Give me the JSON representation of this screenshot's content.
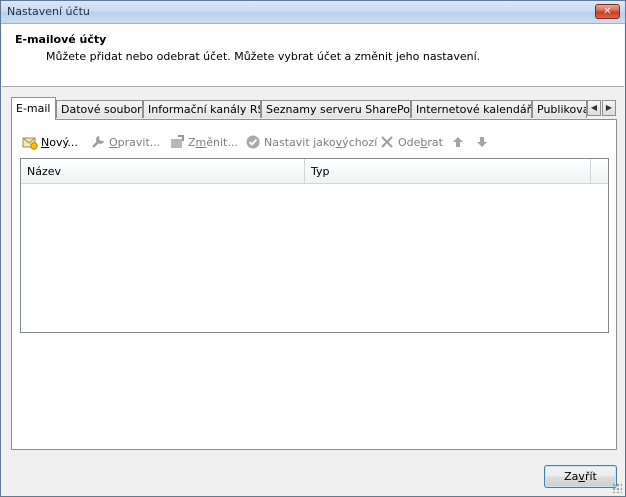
{
  "window": {
    "title": "Nastavení účtu",
    "close_glyph": "✕"
  },
  "header": {
    "title": "E-mailové účty",
    "subtitle": "Můžete přidat nebo odebrat účet. Můžete vybrat účet a změnit jeho nastavení."
  },
  "tabs": [
    {
      "label": "E-mail",
      "active": true
    },
    {
      "label": "Datové soubory"
    },
    {
      "label": "Informační kanály RSS"
    },
    {
      "label": "Seznamy serveru SharePoint"
    },
    {
      "label": "Internetové kalendáře"
    },
    {
      "label": "Publikovan"
    }
  ],
  "tab_scroll": {
    "left_glyph": "◀",
    "right_glyph": "▶"
  },
  "toolbar": {
    "new_pre": "",
    "new_key": "N",
    "new_post": "ový...",
    "repair_pre": "",
    "repair_key": "O",
    "repair_post": "pravit...",
    "change_pre": "Z",
    "change_key": "m",
    "change_post": "ěnit...",
    "default_pre": "Nastavit jako ",
    "default_key": "v",
    "default_post": "ýchozí",
    "remove_pre": "Ode",
    "remove_key": "b",
    "remove_post": "rat"
  },
  "list": {
    "columns": [
      "Název",
      "Typ"
    ],
    "rows": []
  },
  "footer": {
    "close_pre": "Za",
    "close_key": "v",
    "close_post": "řít"
  }
}
